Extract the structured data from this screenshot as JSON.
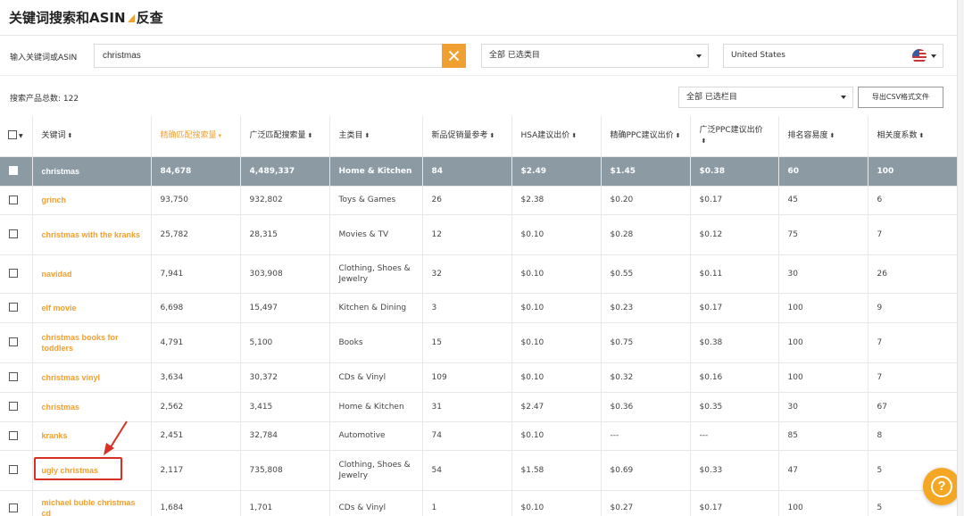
{
  "page": {
    "title_prefix": "关键词搜索和ASIN",
    "title_suffix": "反查"
  },
  "search": {
    "label": "输入关键词或ASIN",
    "value": "christmas",
    "clear_icon": "close-icon"
  },
  "category_select": {
    "value": "全部  已选类目"
  },
  "country_select": {
    "value": "United States",
    "flag_icon": "us-flag-icon"
  },
  "results": {
    "count_label": "搜索产品总数:  122",
    "column_select": "全部  已选栏目",
    "export_label": "导出CSV格式文件"
  },
  "table": {
    "headers": [
      {
        "label": "关键词",
        "sort": "⬍"
      },
      {
        "label": "精确匹配搜索量",
        "sort": "▾",
        "active": true
      },
      {
        "label": "广泛匹配搜索量",
        "sort": "⬍"
      },
      {
        "label": "主类目",
        "sort": "⬍"
      },
      {
        "label": "新品促销量参考",
        "sort": "⬍"
      },
      {
        "label": "HSA建议出价",
        "sort": "⬍"
      },
      {
        "label": "精确PPC建议出价",
        "sort": "⬍"
      },
      {
        "label": "广泛PPC建议出价",
        "sort": "⬍"
      },
      {
        "label": "排名容易度",
        "sort": "⬍"
      },
      {
        "label": "相关度系数",
        "sort": "⬍"
      }
    ],
    "rows": [
      {
        "keyword": "christmas",
        "exact": "84,678",
        "broad": "4,489,337",
        "category": "Home & Kitchen",
        "promo": "84",
        "hsa": "$2.49",
        "ppc_exact": "$1.45",
        "ppc_broad": "$0.38",
        "rank": "60",
        "relevance": "100",
        "highlight": true
      },
      {
        "keyword": "grinch",
        "exact": "93,750",
        "broad": "932,802",
        "category": "Toys & Games",
        "promo": "26",
        "hsa": "$2.38",
        "ppc_exact": "$0.20",
        "ppc_broad": "$0.17",
        "rank": "45",
        "relevance": "6"
      },
      {
        "keyword": "christmas with the kranks",
        "exact": "25,782",
        "broad": "28,315",
        "category": "Movies & TV",
        "promo": "12",
        "hsa": "$0.10",
        "ppc_exact": "$0.28",
        "ppc_broad": "$0.12",
        "rank": "75",
        "relevance": "7"
      },
      {
        "keyword": "navidad",
        "exact": "7,941",
        "broad": "303,908",
        "category": "Clothing, Shoes & Jewelry",
        "promo": "32",
        "hsa": "$0.10",
        "ppc_exact": "$0.55",
        "ppc_broad": "$0.11",
        "rank": "30",
        "relevance": "26"
      },
      {
        "keyword": "elf movie",
        "exact": "6,698",
        "broad": "15,497",
        "category": "Kitchen & Dining",
        "promo": "3",
        "hsa": "$0.10",
        "ppc_exact": "$0.23",
        "ppc_broad": "$0.17",
        "rank": "100",
        "relevance": "9"
      },
      {
        "keyword": "christmas books for toddlers",
        "exact": "4,791",
        "broad": "5,100",
        "category": "Books",
        "promo": "15",
        "hsa": "$0.10",
        "ppc_exact": "$0.75",
        "ppc_broad": "$0.38",
        "rank": "100",
        "relevance": "7"
      },
      {
        "keyword": "christmas vinyl",
        "exact": "3,634",
        "broad": "30,372",
        "category": "CDs & Vinyl",
        "promo": "109",
        "hsa": "$0.10",
        "ppc_exact": "$0.32",
        "ppc_broad": "$0.16",
        "rank": "100",
        "relevance": "7"
      },
      {
        "keyword": "christmas",
        "exact": "2,562",
        "broad": "3,415",
        "category": "Home & Kitchen",
        "promo": "31",
        "hsa": "$2.47",
        "ppc_exact": "$0.36",
        "ppc_broad": "$0.35",
        "rank": "30",
        "relevance": "67"
      },
      {
        "keyword": "kranks",
        "exact": "2,451",
        "broad": "32,784",
        "category": "Automotive",
        "promo": "74",
        "hsa": "$0.10",
        "ppc_exact": "---",
        "ppc_broad": "---",
        "rank": "85",
        "relevance": "8"
      },
      {
        "keyword": "ugly christmas",
        "exact": "2,117",
        "broad": "735,808",
        "category": "Clothing, Shoes & Jewelry",
        "promo": "54",
        "hsa": "$1.58",
        "ppc_exact": "$0.69",
        "ppc_broad": "$0.33",
        "rank": "47",
        "relevance": "5"
      },
      {
        "keyword": "michael buble christmas cd",
        "exact": "1,684",
        "broad": "1,701",
        "category": "CDs & Vinyl",
        "promo": "1",
        "hsa": "$0.10",
        "ppc_exact": "$0.27",
        "ppc_broad": "$0.17",
        "rank": "100",
        "relevance": "5"
      }
    ]
  },
  "colors": {
    "accent": "#f0a030",
    "highlight_row": "#8b9aa3",
    "annotation": "#d93025"
  },
  "help": {
    "label": "?",
    "icon": "help-icon"
  }
}
